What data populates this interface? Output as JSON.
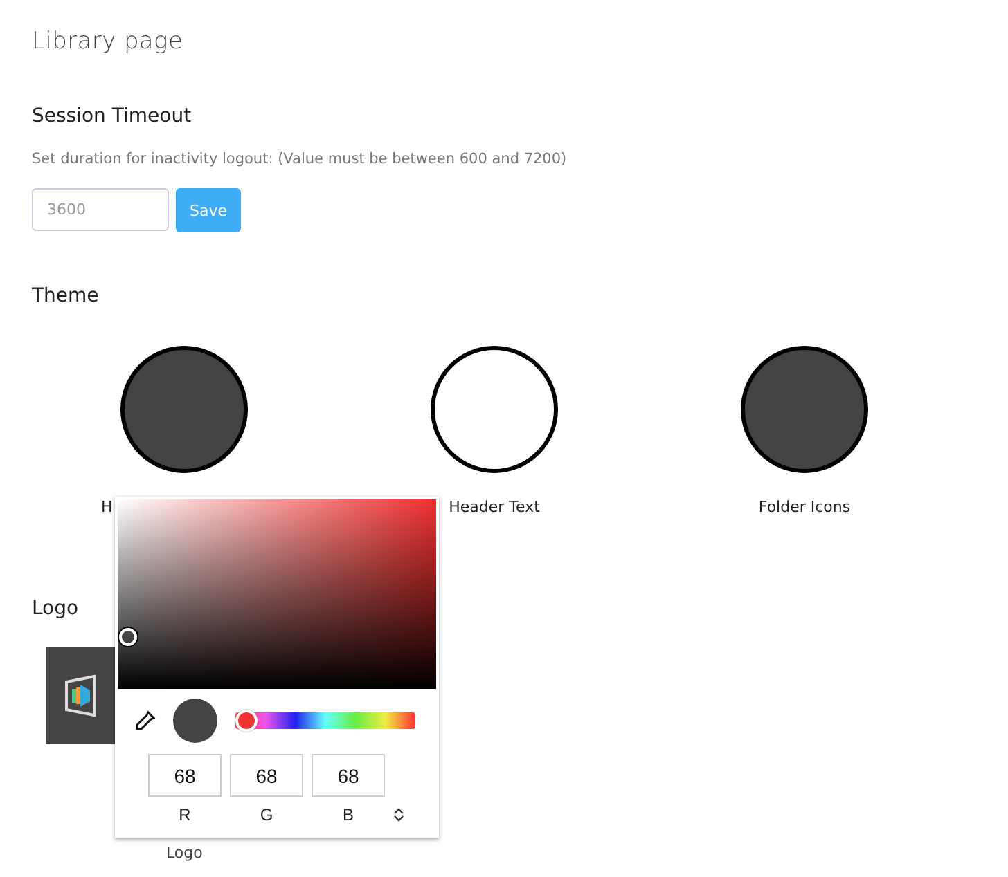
{
  "page_title": "Library page",
  "session_timeout": {
    "heading": "Session Timeout",
    "description": "Set duration for inactivity logout: (Value must be between 600 and 7200)",
    "placeholder": "3600",
    "button": "Save"
  },
  "theme": {
    "heading": "Theme",
    "swatches": [
      {
        "label": "H",
        "color": "#444444"
      },
      {
        "label": "Header Text",
        "color": "#ffffff"
      },
      {
        "label": "Folder Icons",
        "color": "#444444"
      }
    ]
  },
  "logo": {
    "heading": "Logo",
    "caption": "Logo"
  },
  "color_picker": {
    "hue": {
      "level": 0
    },
    "channels": [
      {
        "label": "R",
        "value": "68"
      },
      {
        "label": "G",
        "value": "68"
      },
      {
        "label": "B",
        "value": "68"
      }
    ]
  }
}
